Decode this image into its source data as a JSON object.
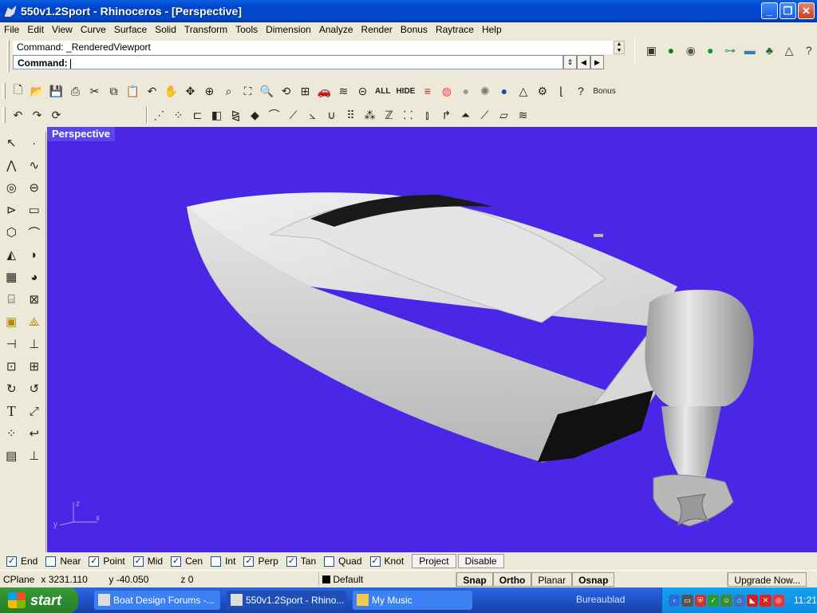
{
  "window": {
    "title": "550v1.2Sport - Rhinoceros - [Perspective]",
    "minimize": "_",
    "maximize": "❐",
    "close": "✕"
  },
  "menu": [
    "File",
    "Edit",
    "View",
    "Curve",
    "Surface",
    "Solid",
    "Transform",
    "Tools",
    "Dimension",
    "Analyze",
    "Render",
    "Bonus",
    "Raytrace",
    "Help"
  ],
  "command": {
    "history": "Command: _RenderedViewport",
    "prompt_label": "Command:",
    "value": ""
  },
  "toolbar1": {
    "all_label": "ALL",
    "hide_label": "HIDE",
    "bonus_label": "Bonus"
  },
  "viewport": {
    "label": "Perspective",
    "background": "#4a27e6",
    "axis_z": "z",
    "axis_y": "y",
    "axis_x": "x"
  },
  "osnaps": [
    {
      "label": "End",
      "checked": true
    },
    {
      "label": "Near",
      "checked": false
    },
    {
      "label": "Point",
      "checked": true
    },
    {
      "label": "Mid",
      "checked": true
    },
    {
      "label": "Cen",
      "checked": true
    },
    {
      "label": "Int",
      "checked": false
    },
    {
      "label": "Perp",
      "checked": true
    },
    {
      "label": "Tan",
      "checked": true
    },
    {
      "label": "Quad",
      "checked": false
    },
    {
      "label": "Knot",
      "checked": true
    }
  ],
  "osnap_buttons": {
    "project": "Project",
    "disable": "Disable"
  },
  "status": {
    "cplane": "CPlane",
    "x": "x 3231.110",
    "y": "y -40.050",
    "z": "z 0",
    "layer": "Default",
    "snap": "Snap",
    "ortho": "Ortho",
    "planar": "Planar",
    "osnap": "Osnap",
    "upgrade": "Upgrade Now..."
  },
  "taskbar": {
    "start": "start",
    "tasks": [
      "Boat Design Forums -...",
      "550v1.2Sport - Rhino...",
      "My Music"
    ],
    "quicklaunch": "Bureaublad",
    "clock": "11:21"
  }
}
